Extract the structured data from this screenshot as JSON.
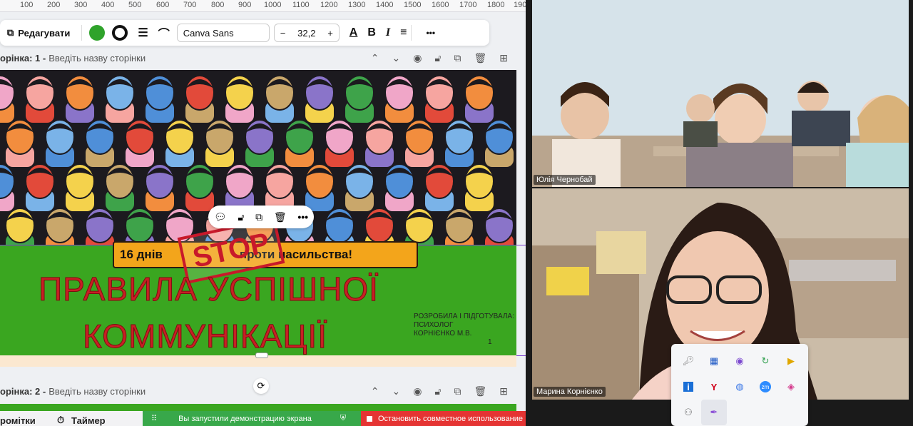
{
  "ruler": {
    "ticks": [
      "100",
      "200",
      "300",
      "400",
      "500",
      "600",
      "700",
      "800",
      "900",
      "1000",
      "1100",
      "1200",
      "1300",
      "1400",
      "1500",
      "1600",
      "1700",
      "1800",
      "190"
    ]
  },
  "toolbar": {
    "edit_label": "Редагувати",
    "font_name": "Canva Sans",
    "font_size": "32,2",
    "minus": "−",
    "plus": "+",
    "bold": "B",
    "italic": "I",
    "more": "•••"
  },
  "page1": {
    "title": "орінка: 1 -",
    "subtitle": "Введіть назву сторінки"
  },
  "page2": {
    "title": "орінка: 2 -",
    "subtitle": "Введіть назву сторінки"
  },
  "slide": {
    "banner_left": "16 днів",
    "banner_right": "проти  насильства!",
    "stop": "STOP",
    "title_line1": "ПРАВИЛА УСПІШНОЇ",
    "title_line2": "КОММУНІКАЦІЇ",
    "author_line1": "РОЗРОБИЛА І ПІДГОТУВАЛА:",
    "author_line2": "ПСИХОЛОГ",
    "author_line3": "КОРНІЄНКО М.В.",
    "page_number": "1"
  },
  "bottom": {
    "notes": "ромітки",
    "timer": "Таймер",
    "share_on": "Вы запустили демонстрацию экрана",
    "share_off": "Остановить совместное использование"
  },
  "participants": {
    "p1": "Юлія Чернобай",
    "p2": "Марина Корнієнко"
  },
  "colors": {
    "green": "#3aa620",
    "red": "#c81f24",
    "orange": "#f3a51b",
    "share_green": "#38a84a",
    "share_red": "#e53433"
  }
}
